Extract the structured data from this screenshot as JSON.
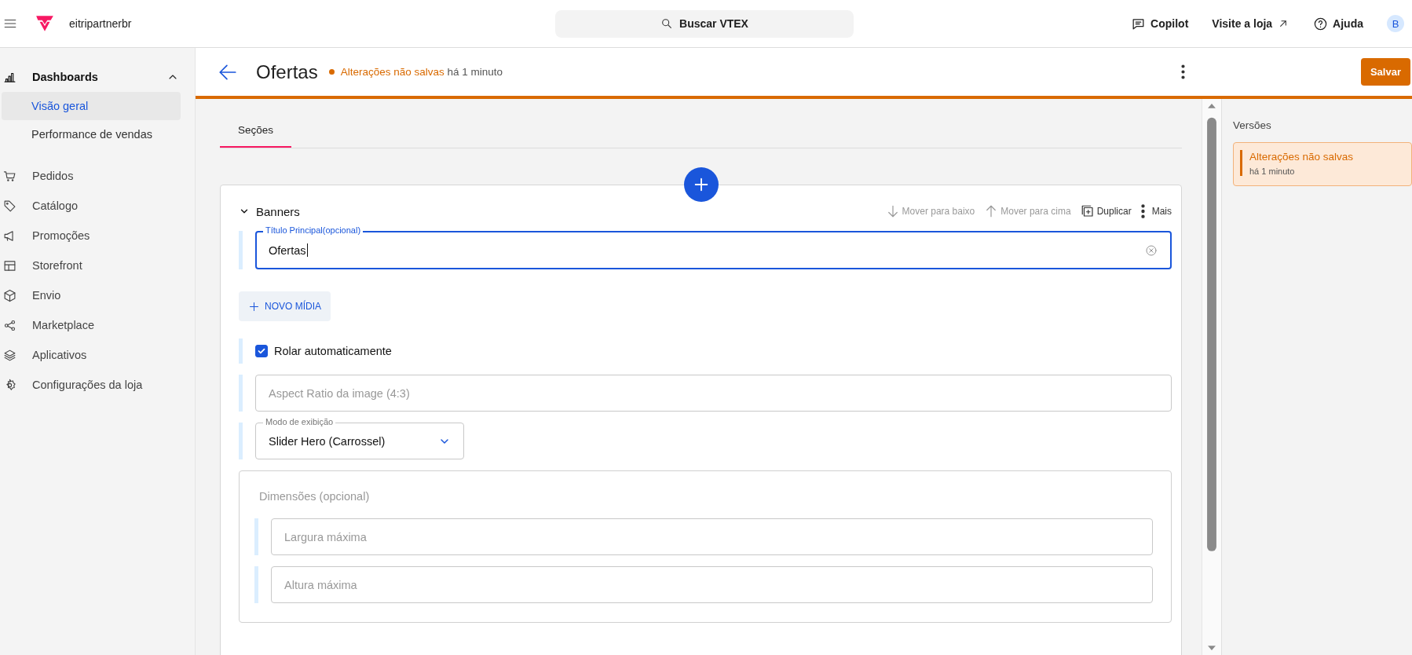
{
  "topbar": {
    "brand": "eitripartnerbr",
    "search": {
      "placeholder": "Buscar VTEX"
    },
    "actions": [
      {
        "kind": "chat",
        "label": "Copilot"
      },
      {
        "kind": "external",
        "label": "Visite a loja"
      },
      {
        "kind": "help",
        "label": "Ajuda"
      }
    ],
    "avatar": "B"
  },
  "sidebar": {
    "items": [
      {
        "kind": "chart",
        "label": "Dashboards",
        "expanded": true,
        "children": [
          {
            "label": "Visão geral",
            "selected": true
          },
          {
            "label": "Performance de vendas",
            "selected": false
          }
        ]
      },
      {
        "kind": "cart",
        "label": "Pedidos"
      },
      {
        "kind": "tag",
        "label": "Catálogo"
      },
      {
        "kind": "megaphone",
        "label": "Promoções"
      },
      {
        "kind": "layout",
        "label": "Storefront"
      },
      {
        "kind": "box",
        "label": "Envio"
      },
      {
        "kind": "share",
        "label": "Marketplace"
      },
      {
        "kind": "layers",
        "label": "Aplicativos"
      },
      {
        "kind": "gear",
        "label": "Configurações da loja"
      }
    ]
  },
  "header": {
    "title": "Ofertas",
    "status": "Alterações não salvas",
    "time": "há 1 minuto",
    "save": "Salvar"
  },
  "tabs": [
    {
      "label": "Seções",
      "selected": true
    }
  ],
  "section": {
    "title": "Banners",
    "expanded": true,
    "actions": [
      {
        "kind": "down",
        "label": "Mover para baixo",
        "disabled": true
      },
      {
        "kind": "up",
        "label": "Mover para cima",
        "disabled": true
      },
      {
        "kind": "duplicate",
        "label": "Duplicar",
        "disabled": false
      },
      {
        "kind": "more",
        "label": "Mais",
        "disabled": false
      }
    ],
    "fields": [
      {
        "kind": "text",
        "label": "Título Principal(opcional)",
        "value": "Ofertas",
        "focused": true
      },
      {
        "kind": "button",
        "label": "NOVO MÍDIA"
      },
      {
        "kind": "checkbox",
        "label": "Rolar automaticamente",
        "checked": true
      },
      {
        "kind": "text",
        "placeholder": "Aspect Ratio da image (4:3)",
        "focused": false
      },
      {
        "kind": "select",
        "label": "Modo de exibição",
        "value": "Slider Hero (Carrossel)"
      },
      {
        "kind": "group",
        "title": "Dimensões (opcional)",
        "fields": [
          {
            "kind": "text",
            "placeholder": "Largura máxima",
            "focused": false
          },
          {
            "kind": "text",
            "placeholder": "Altura máxima",
            "focused": false
          }
        ]
      }
    ]
  },
  "versions": {
    "title": "Versões",
    "items": [
      {
        "title": "Alterações não salvas",
        "time": "há 1 minuto",
        "selected": true
      }
    ]
  }
}
